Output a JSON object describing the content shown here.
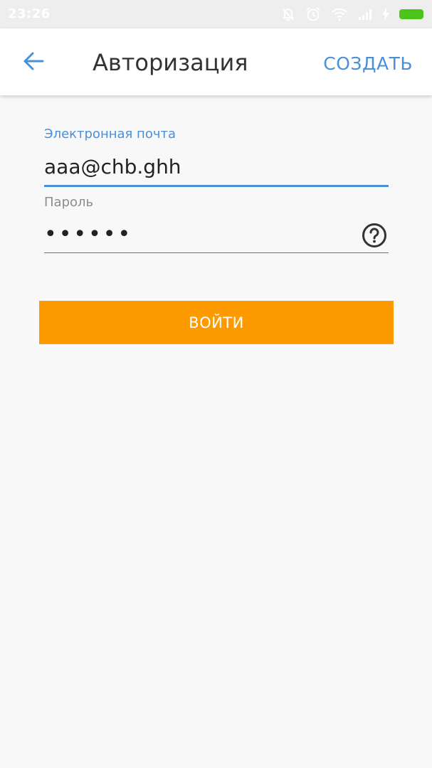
{
  "status_bar": {
    "time": "23:26",
    "icons": [
      "notifications-off-icon",
      "alarm-icon",
      "wifi-icon",
      "signal-icon",
      "charging-icon",
      "battery-icon"
    ],
    "battery_color": "#4cc41a"
  },
  "app_bar": {
    "back_icon": "arrow-back-icon",
    "title": "Авторизация",
    "create_label": "СОЗДАТЬ"
  },
  "form": {
    "email": {
      "label": "Электронная почта",
      "value": "aaa@chb.ghh"
    },
    "password": {
      "label": "Пароль",
      "value": "••••••",
      "help_icon": "help-circle-icon"
    },
    "login_label": "ВОЙТИ"
  },
  "colors": {
    "accent": "#4a90d9",
    "button": "#fc9a00",
    "background": "#f8f8f8",
    "status_bar": "#eeeeee"
  }
}
